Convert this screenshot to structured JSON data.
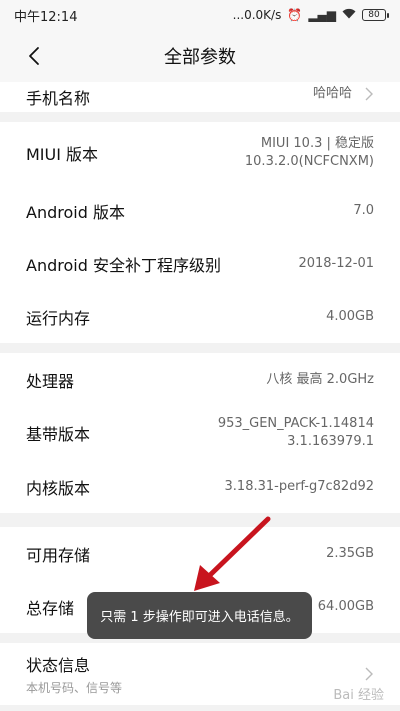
{
  "status_bar": {
    "time": "中午12:14",
    "network": "...0.0K/s",
    "battery": "80"
  },
  "header": {
    "title": "全部参数"
  },
  "device_name": {
    "label": "手机名称",
    "value": "哈哈哈"
  },
  "system_group": [
    {
      "label": "MIUI 版本",
      "value_line1": "MIUI 10.3 | 稳定版",
      "value_line2": "10.3.2.0(NCFCNXM)"
    },
    {
      "label": "Android 版本",
      "value": "7.0"
    },
    {
      "label": "Android 安全补丁程序级别",
      "value": "2018-12-01"
    },
    {
      "label": "运行内存",
      "value": "4.00GB"
    }
  ],
  "hardware_group": [
    {
      "label": "处理器",
      "value": "八核 最高 2.0GHz"
    },
    {
      "label": "基带版本",
      "value_line1": "953_GEN_PACK-1.14814",
      "value_line2": "3.1.163979.1"
    },
    {
      "label": "内核版本",
      "value": "3.18.31-perf-g7c82d92"
    }
  ],
  "storage_group": [
    {
      "label": "可用存储",
      "value": "2.35GB"
    },
    {
      "label": "总存储",
      "value": "64.00GB"
    }
  ],
  "status_info": {
    "label": "状态信息",
    "sub": "本机号码、信号等"
  },
  "toast": {
    "text": "只需 1 步操作即可进入电话信息。"
  },
  "watermark": {
    "text": "Bai 经验"
  },
  "colors": {
    "toast_bg": "#4a4a4a",
    "arrow": "#c8141e"
  }
}
